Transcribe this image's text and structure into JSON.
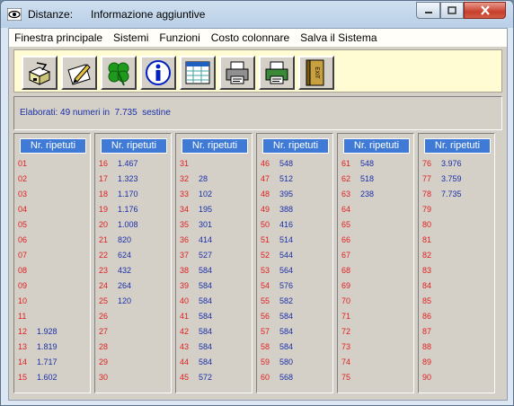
{
  "window": {
    "app_title": "Distanze:",
    "subtitle": "Informazione aggiuntive",
    "controls": {
      "min": "minimize",
      "max": "maximize",
      "close": "close"
    }
  },
  "menu": [
    "Finestra principale",
    "Sistemi",
    "Funzioni",
    "Costo colonnare",
    "Salva il Sistema"
  ],
  "toolbar": {
    "buttons": [
      "box-icon",
      "pencil-icon",
      "clover-icon",
      "info-icon",
      "spreadsheet-icon",
      "printer-icon",
      "printer-green-icon",
      "exit-door-icon"
    ],
    "exit_label": "EXIT"
  },
  "info": {
    "text": "Elaborati: 49 numeri in  7.735  sestine"
  },
  "colors": {
    "accent": "#3f7bd6",
    "number": "#e02020",
    "value": "#1a2fa8",
    "toolbar_bg": "#fffbd2"
  },
  "panels": [
    {
      "header": "Nr. ripetuti",
      "rows": [
        {
          "n": "01",
          "v": ""
        },
        {
          "n": "02",
          "v": ""
        },
        {
          "n": "03",
          "v": ""
        },
        {
          "n": "04",
          "v": ""
        },
        {
          "n": "05",
          "v": ""
        },
        {
          "n": "06",
          "v": ""
        },
        {
          "n": "07",
          "v": ""
        },
        {
          "n": "08",
          "v": ""
        },
        {
          "n": "09",
          "v": ""
        },
        {
          "n": "10",
          "v": ""
        },
        {
          "n": "11",
          "v": ""
        },
        {
          "n": "12",
          "v": "1.928"
        },
        {
          "n": "13",
          "v": "1.819"
        },
        {
          "n": "14",
          "v": "1.717"
        },
        {
          "n": "15",
          "v": "1.602"
        }
      ]
    },
    {
      "header": "Nr. ripetuti",
      "rows": [
        {
          "n": "16",
          "v": "1.467"
        },
        {
          "n": "17",
          "v": "1.323"
        },
        {
          "n": "18",
          "v": "1.170"
        },
        {
          "n": "19",
          "v": "1.176"
        },
        {
          "n": "20",
          "v": "1.008"
        },
        {
          "n": "21",
          "v": "820"
        },
        {
          "n": "22",
          "v": "624"
        },
        {
          "n": "23",
          "v": "432"
        },
        {
          "n": "24",
          "v": "264"
        },
        {
          "n": "25",
          "v": "120"
        },
        {
          "n": "26",
          "v": ""
        },
        {
          "n": "27",
          "v": ""
        },
        {
          "n": "28",
          "v": ""
        },
        {
          "n": "29",
          "v": ""
        },
        {
          "n": "30",
          "v": ""
        }
      ]
    },
    {
      "header": "Nr. ripetuti",
      "rows": [
        {
          "n": "31",
          "v": ""
        },
        {
          "n": "32",
          "v": "28"
        },
        {
          "n": "33",
          "v": "102"
        },
        {
          "n": "34",
          "v": "195"
        },
        {
          "n": "35",
          "v": "301"
        },
        {
          "n": "36",
          "v": "414"
        },
        {
          "n": "37",
          "v": "527"
        },
        {
          "n": "38",
          "v": "584"
        },
        {
          "n": "39",
          "v": "584"
        },
        {
          "n": "40",
          "v": "584"
        },
        {
          "n": "41",
          "v": "584"
        },
        {
          "n": "42",
          "v": "584"
        },
        {
          "n": "43",
          "v": "584"
        },
        {
          "n": "44",
          "v": "584"
        },
        {
          "n": "45",
          "v": "572"
        }
      ]
    },
    {
      "header": "Nr. ripetuti",
      "rows": [
        {
          "n": "46",
          "v": "548"
        },
        {
          "n": "47",
          "v": "512"
        },
        {
          "n": "48",
          "v": "395"
        },
        {
          "n": "49",
          "v": "388"
        },
        {
          "n": "50",
          "v": "416"
        },
        {
          "n": "51",
          "v": "514"
        },
        {
          "n": "52",
          "v": "544"
        },
        {
          "n": "53",
          "v": "564"
        },
        {
          "n": "54",
          "v": "576"
        },
        {
          "n": "55",
          "v": "582"
        },
        {
          "n": "56",
          "v": "584"
        },
        {
          "n": "57",
          "v": "584"
        },
        {
          "n": "58",
          "v": "584"
        },
        {
          "n": "59",
          "v": "580"
        },
        {
          "n": "60",
          "v": "568"
        }
      ]
    },
    {
      "header": "Nr. ripetuti",
      "rows": [
        {
          "n": "61",
          "v": "548"
        },
        {
          "n": "62",
          "v": "518"
        },
        {
          "n": "63",
          "v": "238"
        },
        {
          "n": "64",
          "v": ""
        },
        {
          "n": "65",
          "v": ""
        },
        {
          "n": "66",
          "v": ""
        },
        {
          "n": "67",
          "v": ""
        },
        {
          "n": "68",
          "v": ""
        },
        {
          "n": "69",
          "v": ""
        },
        {
          "n": "70",
          "v": ""
        },
        {
          "n": "71",
          "v": ""
        },
        {
          "n": "72",
          "v": ""
        },
        {
          "n": "73",
          "v": ""
        },
        {
          "n": "74",
          "v": ""
        },
        {
          "n": "75",
          "v": ""
        }
      ]
    },
    {
      "header": "Nr. ripetuti",
      "rows": [
        {
          "n": "76",
          "v": "3.976"
        },
        {
          "n": "77",
          "v": "3.759"
        },
        {
          "n": "78",
          "v": "7.735"
        },
        {
          "n": "79",
          "v": ""
        },
        {
          "n": "80",
          "v": ""
        },
        {
          "n": "81",
          "v": ""
        },
        {
          "n": "82",
          "v": ""
        },
        {
          "n": "83",
          "v": ""
        },
        {
          "n": "84",
          "v": ""
        },
        {
          "n": "85",
          "v": ""
        },
        {
          "n": "86",
          "v": ""
        },
        {
          "n": "87",
          "v": ""
        },
        {
          "n": "88",
          "v": ""
        },
        {
          "n": "89",
          "v": ""
        },
        {
          "n": "90",
          "v": ""
        }
      ]
    }
  ]
}
